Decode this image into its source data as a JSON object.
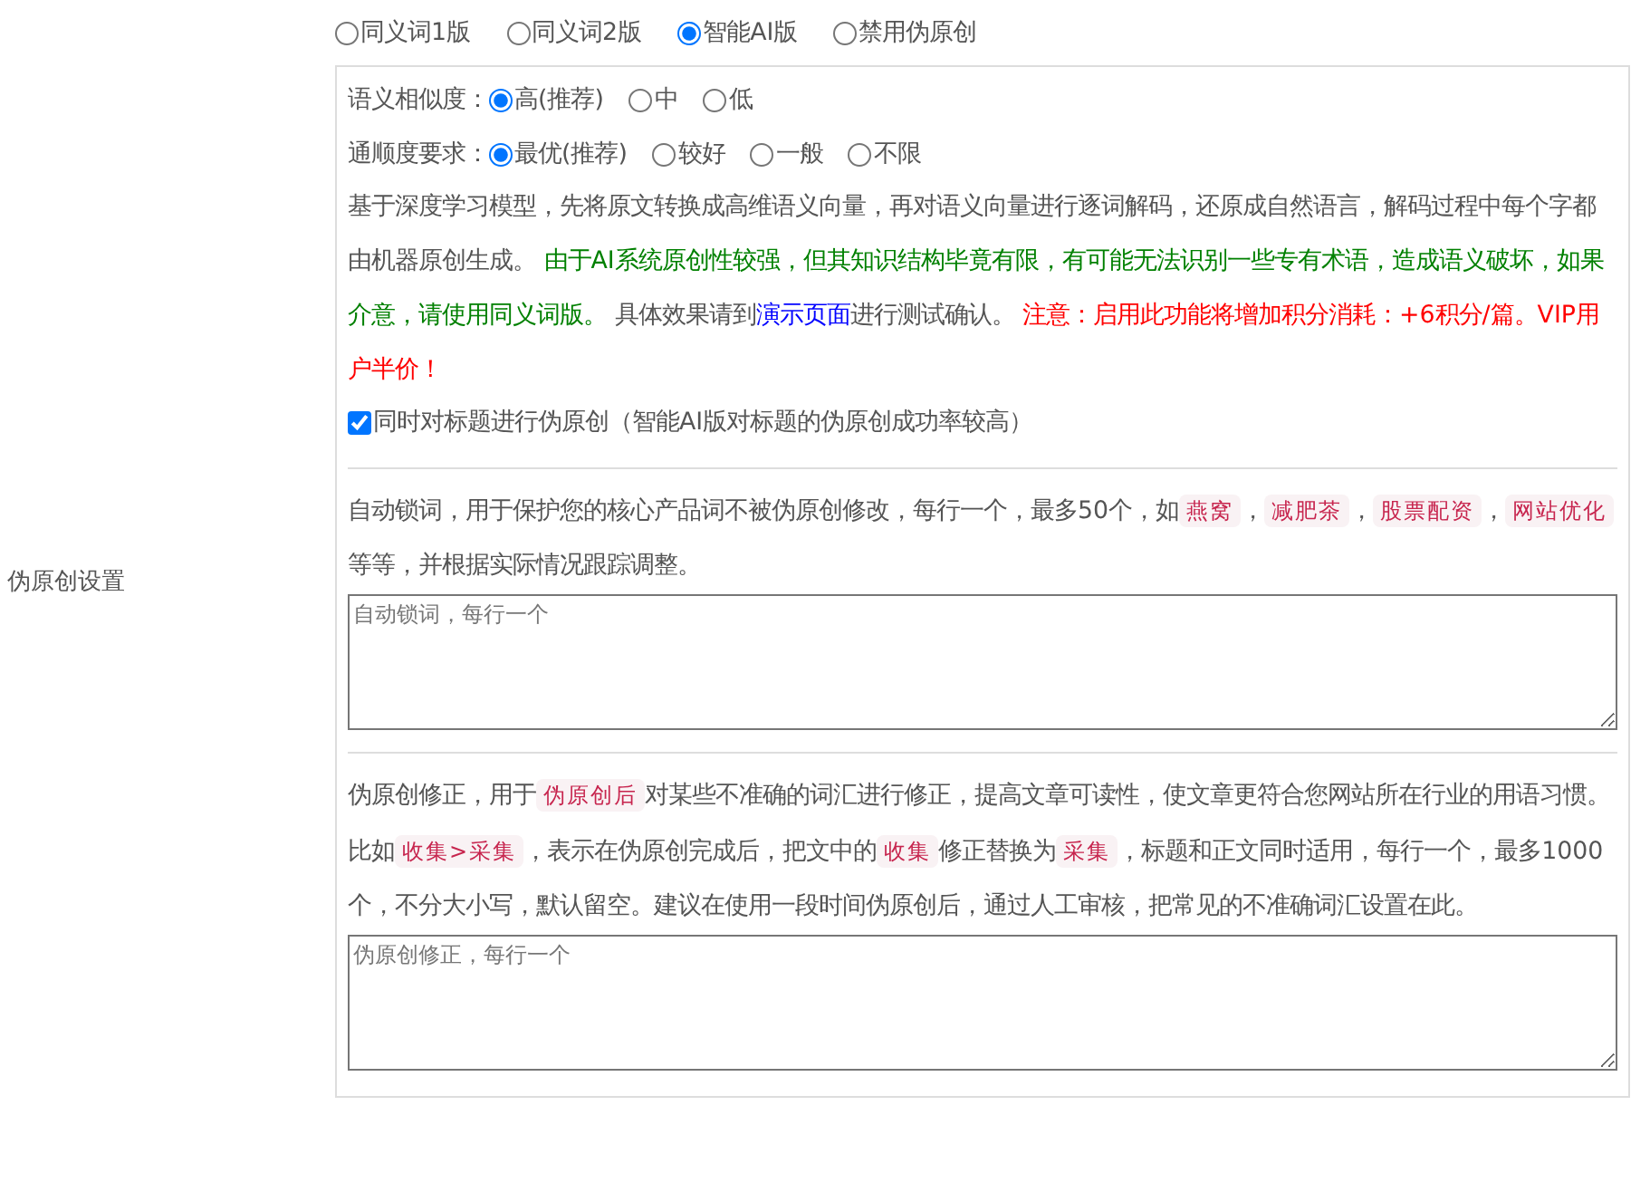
{
  "modes": [
    {
      "label": "同义词1版",
      "selected": false
    },
    {
      "label": "同义词2版",
      "selected": false
    },
    {
      "label": "智能AI版",
      "selected": true
    },
    {
      "label": "禁用伪原创",
      "selected": false
    }
  ],
  "section_label": "伪原创设置",
  "similarity": {
    "label": "语义相似度：",
    "options": [
      {
        "label": "高(推荐)",
        "selected": true
      },
      {
        "label": "中",
        "selected": false
      },
      {
        "label": "低",
        "selected": false
      }
    ]
  },
  "fluency": {
    "label": "通顺度要求：",
    "options": [
      {
        "label": "最优(推荐)",
        "selected": true
      },
      {
        "label": "较好",
        "selected": false
      },
      {
        "label": "一般",
        "selected": false
      },
      {
        "label": "不限",
        "selected": false
      }
    ]
  },
  "ai_description": [
    {
      "kind": "plain",
      "text": "基于深度学习模型，先将原文转换成高维语义向量，再对语义向量进行逐词解码，还原成自然语言，解码过程中每个字都由机器原创生成。 "
    },
    {
      "kind": "green",
      "text": "由于AI系统原创性较强，但其知识结构毕竟有限，有可能无法识别一些专有术语，造成语义破坏，如果介意，请使用同义词版。"
    },
    {
      "kind": "plain",
      "text": " 具体效果请到"
    },
    {
      "kind": "link",
      "text": "演示页面"
    },
    {
      "kind": "plain",
      "text": "进行测试确认。 "
    },
    {
      "kind": "red",
      "text": "注意：启用此功能将增加积分消耗：+6积分/篇。VIP用户半价！"
    }
  ],
  "title_option": {
    "label": "同时对标题进行伪原创（智能AI版对标题的伪原创成功率较高）",
    "checked": true
  },
  "lock_words": {
    "description": [
      {
        "kind": "plain",
        "text": "自动锁词，用于保护您的核心产品词不被伪原创修改，每行一个，最多50个，如"
      },
      {
        "kind": "code",
        "text": "燕窝"
      },
      {
        "kind": "plain",
        "text": "，"
      },
      {
        "kind": "code",
        "text": "减肥茶"
      },
      {
        "kind": "plain",
        "text": "，"
      },
      {
        "kind": "code",
        "text": "股票配资"
      },
      {
        "kind": "plain",
        "text": "，"
      },
      {
        "kind": "code",
        "text": "网站优化"
      },
      {
        "kind": "plain",
        "text": " 等等，并根据实际情况跟踪调整。"
      }
    ],
    "placeholder": "自动锁词，每行一个"
  },
  "correction": {
    "description": [
      {
        "kind": "plain",
        "text": "伪原创修正，用于"
      },
      {
        "kind": "code",
        "text": "伪原创后"
      },
      {
        "kind": "plain",
        "text": "对某些不准确的词汇进行修正，提高文章可读性，使文章更符合您网站所在行业的用语习惯。比如"
      },
      {
        "kind": "code",
        "text": "收集>采集"
      },
      {
        "kind": "plain",
        "text": "，表示在伪原创完成后，把文中的"
      },
      {
        "kind": "code",
        "text": "收集"
      },
      {
        "kind": "plain",
        "text": "修正替换为"
      },
      {
        "kind": "code",
        "text": "采集"
      },
      {
        "kind": "plain",
        "text": "，标题和正文同时适用，每行一个，最多1000个，不分大小写，默认留空。建议在使用一段时间伪原创后，通过人工审核，把常见的不准确词汇设置在此。"
      }
    ],
    "placeholder": "伪原创修正，每行一个"
  }
}
